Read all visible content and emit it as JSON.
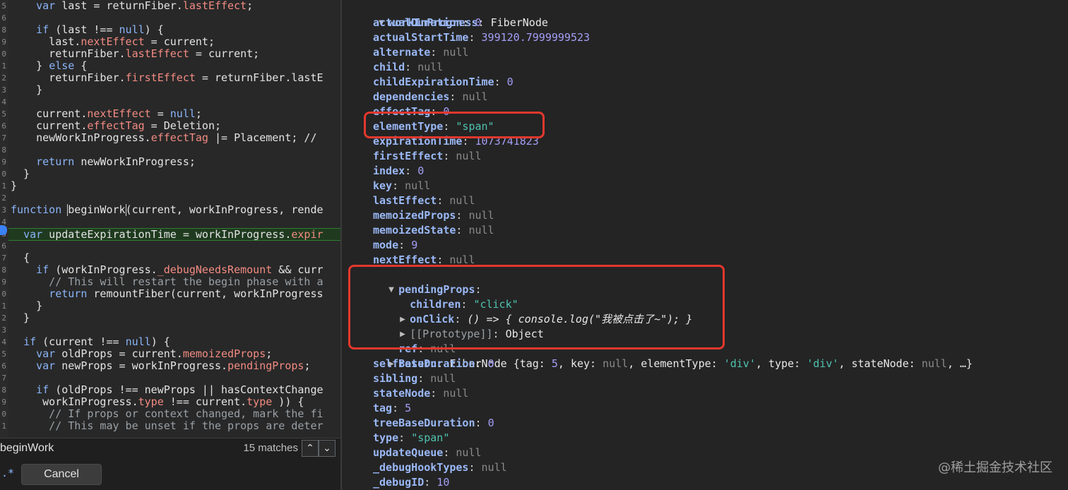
{
  "editor": {
    "line_numbers": [
      "5",
      "6",
      "8",
      "9",
      "0",
      "1",
      "2",
      "3",
      "4",
      "5",
      "6",
      "7",
      "8",
      "9",
      "0",
      "1",
      "2",
      "3",
      "4",
      "5",
      "6",
      "7",
      "8",
      "9",
      "0",
      "1",
      "2",
      "3",
      "4",
      "5",
      "6",
      "7",
      "8",
      "9",
      "0",
      "1"
    ],
    "lines": [
      {
        "t": 0,
        "parts": [
          [
            "    ",
            ""
          ],
          [
            "var",
            "kw"
          ],
          [
            " last = returnFiber.",
            ""
          ],
          [
            "lastEffect",
            "prop"
          ],
          [
            ";",
            ""
          ]
        ]
      },
      {
        "t": 34,
        "parts": [
          [
            "    ",
            ""
          ],
          [
            "if",
            "kw"
          ],
          [
            " (last !== ",
            ""
          ],
          [
            "null",
            "kw"
          ],
          [
            ") {",
            ""
          ]
        ]
      },
      {
        "t": 51,
        "parts": [
          [
            "      last.",
            ""
          ],
          [
            "nextEffect",
            "prop"
          ],
          [
            " = current;",
            ""
          ]
        ]
      },
      {
        "t": 68,
        "parts": [
          [
            "      returnFiber.",
            ""
          ],
          [
            "lastEffect",
            "prop"
          ],
          [
            " = current;",
            ""
          ]
        ]
      },
      {
        "t": 85,
        "parts": [
          [
            "    } ",
            ""
          ],
          [
            "else",
            "kw"
          ],
          [
            " {",
            ""
          ]
        ]
      },
      {
        "t": 102,
        "parts": [
          [
            "      returnFiber.",
            ""
          ],
          [
            "firstEffect",
            "prop"
          ],
          [
            " = returnFiber.lastE",
            ""
          ]
        ]
      },
      {
        "t": 119,
        "parts": [
          [
            "    }",
            ""
          ]
        ]
      },
      {
        "t": 153,
        "parts": [
          [
            "    current.",
            ""
          ],
          [
            "nextEffect",
            "prop"
          ],
          [
            " = ",
            ""
          ],
          [
            "null",
            "kw"
          ],
          [
            ";",
            ""
          ]
        ]
      },
      {
        "t": 170,
        "parts": [
          [
            "    current.",
            ""
          ],
          [
            "effectTag",
            "prop"
          ],
          [
            " = Deletion;",
            ""
          ]
        ]
      },
      {
        "t": 187,
        "parts": [
          [
            "    newWorkInProgress.",
            ""
          ],
          [
            "effectTag",
            "prop"
          ],
          [
            " |= Placement; //",
            ""
          ]
        ]
      },
      {
        "t": 221,
        "parts": [
          [
            "    ",
            ""
          ],
          [
            "return",
            "kw"
          ],
          [
            " newWorkInProgress;",
            ""
          ]
        ]
      },
      {
        "t": 238,
        "parts": [
          [
            "  }",
            ""
          ]
        ]
      },
      {
        "t": 255,
        "parts": [
          [
            "}",
            ""
          ]
        ]
      },
      {
        "t": 289,
        "parts": [
          [
            "function",
            "kw"
          ],
          [
            " ",
            ""
          ],
          [
            "beginWork",
            "fnhl"
          ],
          [
            "(current, workInProgress, rende",
            ""
          ]
        ]
      },
      {
        "t": 323,
        "exec": true,
        "parts": [
          [
            "  ",
            ""
          ],
          [
            "var",
            "kw"
          ],
          [
            " updateExpirationTime = workInProgress.",
            ""
          ],
          [
            "expir",
            "prop"
          ]
        ]
      },
      {
        "t": 357,
        "parts": [
          [
            "  {",
            ""
          ]
        ]
      },
      {
        "t": 374,
        "parts": [
          [
            "    ",
            ""
          ],
          [
            "if",
            "kw"
          ],
          [
            " (workInProgress.",
            ""
          ],
          [
            "_debugNeedsRemount",
            "prop"
          ],
          [
            " && curr",
            ""
          ]
        ]
      },
      {
        "t": 391,
        "parts": [
          [
            "      // This will restart the begin phase with a",
            "cm"
          ]
        ]
      },
      {
        "t": 408,
        "parts": [
          [
            "      ",
            ""
          ],
          [
            "return",
            "kw"
          ],
          [
            " remountFiber(current, workInProgress",
            ""
          ]
        ]
      },
      {
        "t": 425,
        "parts": [
          [
            "    }",
            ""
          ]
        ]
      },
      {
        "t": 442,
        "parts": [
          [
            "  }",
            ""
          ]
        ]
      },
      {
        "t": 476,
        "parts": [
          [
            "  ",
            ""
          ],
          [
            "if",
            "kw"
          ],
          [
            " (current !== ",
            ""
          ],
          [
            "null",
            "kw"
          ],
          [
            ") {",
            ""
          ]
        ]
      },
      {
        "t": 493,
        "parts": [
          [
            "    ",
            ""
          ],
          [
            "var",
            "kw"
          ],
          [
            " oldProps = current.",
            ""
          ],
          [
            "memoizedProps",
            "prop"
          ],
          [
            ";",
            ""
          ]
        ]
      },
      {
        "t": 510,
        "parts": [
          [
            "    ",
            ""
          ],
          [
            "var",
            "kw"
          ],
          [
            " newProps = workInProgress.",
            ""
          ],
          [
            "pendingProps",
            "prop"
          ],
          [
            ";",
            ""
          ]
        ]
      },
      {
        "t": 544,
        "parts": [
          [
            "    ",
            ""
          ],
          [
            "if",
            "kw"
          ],
          [
            " (oldProps !== newProps || hasContextChange",
            ""
          ]
        ]
      },
      {
        "t": 561,
        "parts": [
          [
            "     workInProgress.",
            ""
          ],
          [
            "type",
            "prop"
          ],
          [
            " !== current.",
            ""
          ],
          [
            "type",
            "prop"
          ],
          [
            " )) {",
            ""
          ]
        ]
      },
      {
        "t": 578,
        "parts": [
          [
            "      // If props or context changed, mark the fi",
            "cm"
          ]
        ]
      },
      {
        "t": 595,
        "parts": [
          [
            "      // This may be unset if the props are deter",
            "cm"
          ]
        ]
      }
    ]
  },
  "search": {
    "value": "beginWork",
    "match_count": "15 matches",
    "prev_label": "⌃",
    "next_label": "⌄",
    "regex_label": ".*",
    "cancel_label": "Cancel"
  },
  "inspector": {
    "root_key": "workInProgress",
    "root_type": "FiberNode",
    "rows": [
      {
        "key": "actualDuration",
        "value": "0",
        "vtype": "num"
      },
      {
        "key": "actualStartTime",
        "value": "399120.7999999523",
        "vtype": "num"
      },
      {
        "key": "alternate",
        "value": "null",
        "vtype": "null"
      },
      {
        "key": "child",
        "value": "null",
        "vtype": "null"
      },
      {
        "key": "childExpirationTime",
        "value": "0",
        "vtype": "num"
      },
      {
        "key": "dependencies",
        "value": "null",
        "vtype": "null"
      },
      {
        "key": "effectTag",
        "value": "0",
        "vtype": "num"
      },
      {
        "key": "elementType",
        "value": "\"span\"",
        "vtype": "str"
      },
      {
        "key": "expirationTime",
        "value": "1073741823",
        "vtype": "num"
      },
      {
        "key": "firstEffect",
        "value": "null",
        "vtype": "null"
      },
      {
        "key": "index",
        "value": "0",
        "vtype": "num"
      },
      {
        "key": "key",
        "value": "null",
        "vtype": "null"
      },
      {
        "key": "lastEffect",
        "value": "null",
        "vtype": "null"
      },
      {
        "key": "memoizedProps",
        "value": "null",
        "vtype": "null"
      },
      {
        "key": "memoizedState",
        "value": "null",
        "vtype": "null"
      },
      {
        "key": "mode",
        "value": "9",
        "vtype": "num"
      },
      {
        "key": "nextEffect",
        "value": "null",
        "vtype": "null"
      }
    ],
    "pending": {
      "key": "pendingProps",
      "children_key": "children",
      "children_value": "\"click\"",
      "onclick_key": "onClick",
      "onclick_value": "() => { console.log(\"我被点击了~\"); }",
      "proto_key": "[[Prototype]]",
      "proto_value": "Object"
    },
    "ref_key": "ref",
    "ref_value": "null",
    "return_row": {
      "key": "return",
      "type": "FiberNode",
      "p1": "{tag: ",
      "tag": "5",
      "p2": ", key: ",
      "keyv": "null",
      "p3": ", elementType: ",
      "et": "'div'",
      "p4": ", type: ",
      "ty": "'div'",
      "p5": ", stateNode: ",
      "sn": "null",
      "p6": ", …}"
    },
    "rows2": [
      {
        "key": "selfBaseDuration",
        "value": "0",
        "vtype": "num"
      },
      {
        "key": "sibling",
        "value": "null",
        "vtype": "null"
      },
      {
        "key": "stateNode",
        "value": "null",
        "vtype": "null"
      },
      {
        "key": "tag",
        "value": "5",
        "vtype": "num"
      },
      {
        "key": "treeBaseDuration",
        "value": "0",
        "vtype": "num"
      },
      {
        "key": "type",
        "value": "\"span\"",
        "vtype": "str"
      },
      {
        "key": "updateQueue",
        "value": "null",
        "vtype": "null"
      },
      {
        "key": "_debugHookTypes",
        "value": "null",
        "vtype": "null"
      },
      {
        "key": "_debugID",
        "value": "10",
        "vtype": "num"
      }
    ]
  },
  "watermark": "@稀土掘金技术社区",
  "colors": {
    "highlight_box": "#e2382d",
    "key": "#9ab8f6",
    "number": "#a39ff7",
    "string": "#4fc3b0",
    "null": "#8a8a8a"
  }
}
